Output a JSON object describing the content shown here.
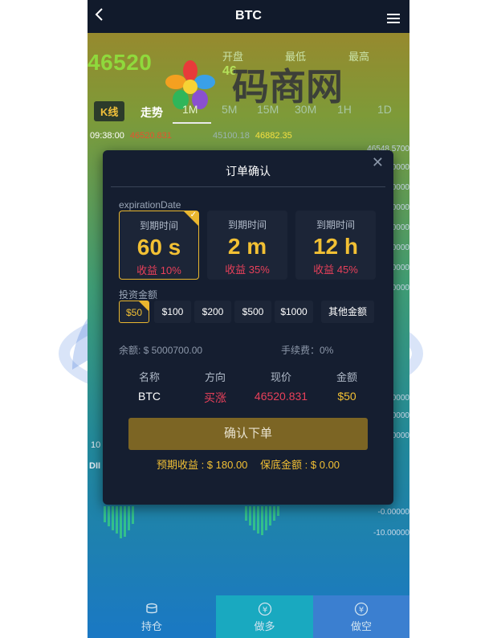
{
  "header": {
    "title": "BTC",
    "back_icon": "chevron-left-icon",
    "menu_icon": "hamburger-icon"
  },
  "price": {
    "current": "46520",
    "labels": [
      "开盘",
      "最低",
      "最高"
    ],
    "values": [
      "46"
    ]
  },
  "tabs": [
    "K线",
    "走势",
    "1M",
    "5M",
    "15M",
    "30M",
    "1H",
    "1D"
  ],
  "ticker": {
    "time": "09:38:00",
    "v1": "46520.831",
    "v2": "45100.18",
    "v3": "46882.35"
  },
  "axis": {
    "top": "46548.5700",
    "right_labels": [
      "00000",
      "00000",
      "00000",
      "00000",
      "00000",
      "00000",
      "00000",
      "00000",
      "00000",
      "00000"
    ],
    "neg1": "-0.00000",
    "neg2": "-10.00000",
    "left1": "10",
    "left2": "DII"
  },
  "modal": {
    "title": "订单确认",
    "expiration_label": "expirationDate",
    "options": [
      {
        "label": "到期时间",
        "value": "60 s",
        "rate": "收益 10%",
        "selected": true
      },
      {
        "label": "到期时间",
        "value": "2 m",
        "rate": "收益 35%",
        "selected": false
      },
      {
        "label": "到期时间",
        "value": "12 h",
        "rate": "收益 45%",
        "selected": false
      }
    ],
    "invest_label": "投资金额",
    "amounts": [
      "$50",
      "$100",
      "$200",
      "$500",
      "$1000",
      "其他金额"
    ],
    "balance": "余额: $ 5000700.00",
    "fee": "手续费：0%",
    "headers": [
      "名称",
      "方向",
      "现价",
      "金额"
    ],
    "row": [
      "BTC",
      "买涨",
      "46520.831",
      "$50"
    ],
    "confirm": "确认下单",
    "expected": "预期收益 : $ 180.00",
    "margin": "保底金额 : $ 0.00"
  },
  "bottom_nav": [
    "持仓",
    "做多",
    "做空"
  ],
  "colors": {
    "accent": "#f2c034",
    "up_red": "#e8405a",
    "green": "#8fd93c"
  }
}
